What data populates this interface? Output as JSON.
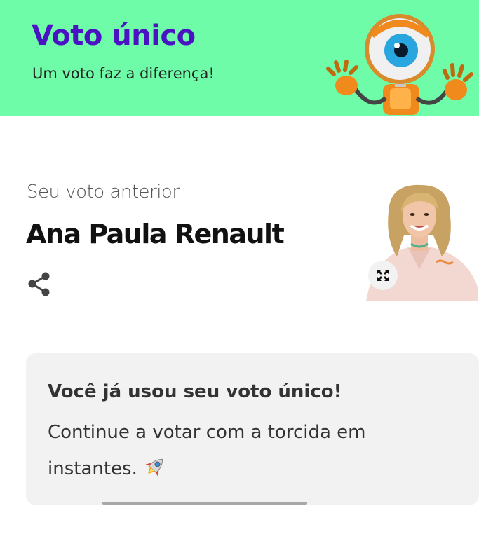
{
  "header": {
    "title": "Voto único",
    "subtitle": "Um voto faz a diferença!",
    "background_color": "#6ffca9",
    "title_color": "#4a12c3",
    "mascot_icon": "big-brother-eye-mascot"
  },
  "previous_vote": {
    "label": "Seu voto anterior",
    "name": "Ana Paula Renault",
    "share_icon": "share-icon",
    "expand_icon": "expand-icon"
  },
  "info_card": {
    "title": "Você já usou seu voto único!",
    "body": "Continue a votar com a torcida em instantes.",
    "emoji": "rocket-icon"
  }
}
